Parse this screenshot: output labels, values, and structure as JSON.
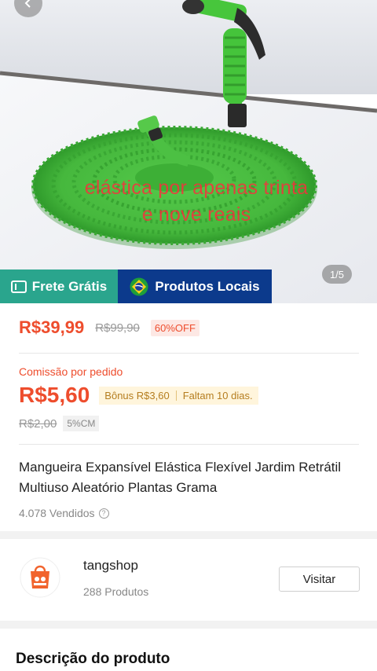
{
  "hero": {
    "overlay_line1": "elástica por apenas trinta",
    "overlay_line2": "e nove reais",
    "image_counter": "1/5",
    "badge_frete": "Frete Grátis",
    "badge_locais": "Produtos Locais",
    "accent_green": "#2aa58d",
    "accent_blue": "#0c3a8c"
  },
  "price": {
    "current": "R$39,99",
    "original": "R$99,90",
    "discount": "60%OFF",
    "accent": "#ee4d2d"
  },
  "commission": {
    "label": "Comissão por pedido",
    "value": "R$5,60",
    "bonus": "Bônus R$3,60",
    "days_left": "Faltam 10 dias.",
    "old_value": "R$2,00",
    "cm_tag": "5%CM"
  },
  "product": {
    "title": "Mangueira Expansível Elástica Flexível Jardim Retrátil Multiuso Aleatório Plantas Grama",
    "sold": "4.078 Vendidos"
  },
  "shop": {
    "name": "tangshop",
    "products": "288 Produtos",
    "visit_label": "Visitar"
  },
  "description": {
    "heading": "Descrição do produto"
  }
}
